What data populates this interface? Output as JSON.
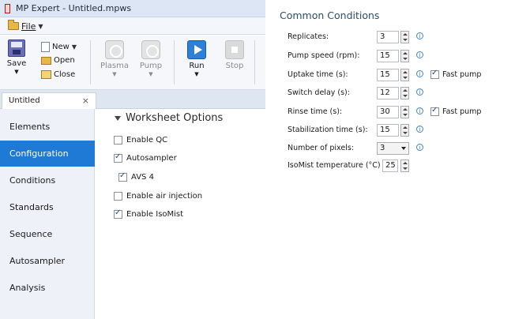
{
  "window": {
    "title": "MP Expert - Untitled.mpws"
  },
  "menu": {
    "file": "File"
  },
  "ribbon": {
    "save": "Save",
    "new": "New",
    "open": "Open",
    "close": "Close",
    "plasma": "Plasma",
    "pump": "Pump",
    "run": "Run",
    "stop": "Stop"
  },
  "document_tab": {
    "name": "Untitled",
    "close_glyph": "×"
  },
  "nav": {
    "items": [
      {
        "label": "Elements",
        "active": false
      },
      {
        "label": "Configuration",
        "active": true
      },
      {
        "label": "Conditions",
        "active": false
      },
      {
        "label": "Standards",
        "active": false
      },
      {
        "label": "Sequence",
        "active": false
      },
      {
        "label": "Autosampler",
        "active": false
      },
      {
        "label": "Analysis",
        "active": false
      }
    ],
    "active_color": "#1f7ad6"
  },
  "worksheet_options": {
    "title": "Worksheet Options",
    "options": [
      {
        "label": "Enable QC",
        "checked": false
      },
      {
        "label": "Autosampler",
        "checked": true
      },
      {
        "label": "AVS 4",
        "checked": true
      },
      {
        "label": "Enable air injection",
        "checked": false
      },
      {
        "label": "Enable IsoMist",
        "checked": true
      }
    ]
  },
  "conditions": {
    "title": "Common Conditions",
    "rows": [
      {
        "label": "Replicates:",
        "value": "3",
        "info": true
      },
      {
        "label": "Pump speed (rpm):",
        "value": "15",
        "info": true
      },
      {
        "label": "Uptake time (s):",
        "value": "15",
        "info": true,
        "fast_pump": {
          "label": "Fast pump",
          "checked": true
        }
      },
      {
        "label": "Switch delay (s):",
        "value": "12",
        "info": true
      },
      {
        "label": "Rinse time (s):",
        "value": "30",
        "info": true,
        "fast_pump": {
          "label": "Fast pump",
          "checked": true
        }
      },
      {
        "label": "Stabilization time (s):",
        "value": "15",
        "info": true
      },
      {
        "label": "Number of pixels:",
        "value": "3",
        "info": true,
        "dropdown": true
      },
      {
        "label": "IsoMist temperature (°C)",
        "value": "25",
        "info": false
      }
    ]
  }
}
